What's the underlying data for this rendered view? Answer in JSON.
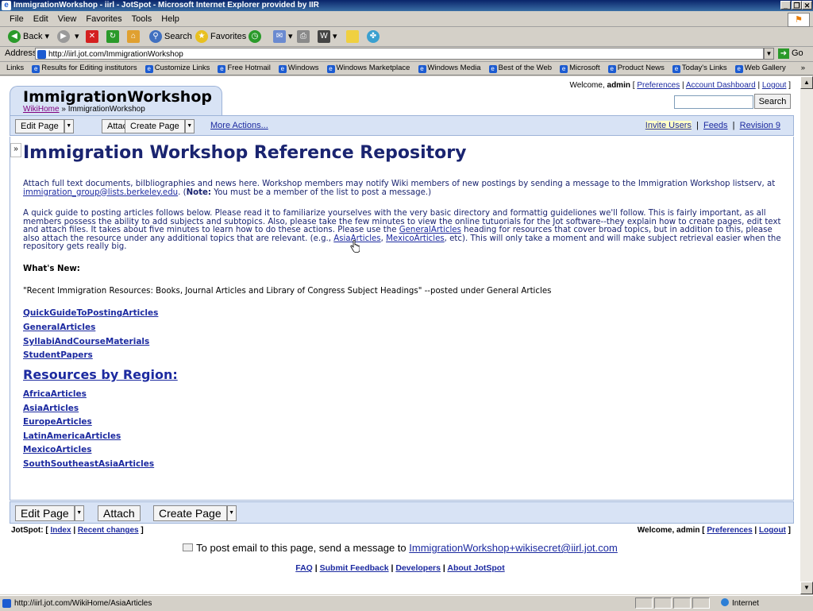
{
  "window": {
    "title": "ImmigrationWorkshop - iirl - JotSpot - Microsoft Internet Explorer provided by IIR"
  },
  "menu": [
    "File",
    "Edit",
    "View",
    "Favorites",
    "Tools",
    "Help"
  ],
  "toolbar": {
    "back": "Back",
    "search": "Search",
    "favorites": "Favorites"
  },
  "address": {
    "label": "Address",
    "url": "http://iirl.jot.com/ImmigrationWorkshop",
    "go": "Go"
  },
  "links": {
    "label": "Links",
    "items": [
      "Results for Editing institutors",
      "Customize Links",
      "Free Hotmail",
      "Windows",
      "Windows Marketplace",
      "Windows Media",
      "Best of the Web",
      "Microsoft",
      "Product News",
      "Today's Links",
      "Web Gallery"
    ]
  },
  "header": {
    "title": "ImmigrationWorkshop",
    "breadcrumb_home": "WikiHome",
    "breadcrumb_sep": " » ",
    "breadcrumb_current": "ImmigrationWorkshop",
    "welcome_prefix": "Welcome, ",
    "user": "admin",
    "preferences": "Preferences",
    "account_dashboard": "Account Dashboard",
    "logout": "Logout",
    "search_button": "Search"
  },
  "actions": {
    "edit_page": "Edit Page",
    "attach": "Attach",
    "create_page": "Create Page",
    "more_actions": "More Actions...",
    "invite_users": "Invite Users",
    "feeds": "Feeds",
    "revision": "Revision 9"
  },
  "content": {
    "heading": "Immigration Workshop Reference Repository",
    "intro_1": "Attach full text documents, bilbliographies and news here.  Workshop members may notify Wiki members of new postings by sending a message to the Immigration Workshop listserv, at",
    "intro_email": "immigration_group@lists.berkeley.edu",
    "intro_note_label": "Note:",
    "intro_note": "  You must be a member of the list to post a message.)",
    "guide_1": "A quick guide to posting articles follows below.  Please read it to familiarize yourselves with the very basic directory and formattig guideliones we'll follow.  This is fairly important, as all members possess the ability to add subjects and subtopics.  Also, please take the few minutes to view the online tutuorials for the Jot software--they explain how to create pages, edit text and attach files.  It takes about five minutes to learn how to do these actions.  Please use the ",
    "guide_link1": "GeneralArticles",
    "guide_2": " heading for resources that cover broad topics, but in addition to this, please also attach the resource under any additional topics that are relevant. (e.g., ",
    "guide_link2": "AsiaArticles",
    "guide_link3": "MexicoArticles",
    "guide_3": ", etc).  This will only take a moment and will make subject retrieval easier when the repository gets really big.",
    "whats_new_label": "What's New:",
    "recent": "\"Recent Immigration Resources:  Books, Journal Articles and  Library of Congress Subject Headings\" --posted under General Articles",
    "topic_links": [
      "QuickGuideToPostingArticles",
      "GeneralArticles",
      "SyllabiAndCourseMaterials",
      "StudentPapers"
    ],
    "region_heading": "Resources by Region:",
    "region_links": [
      "AfricaArticles",
      "AsiaArticles",
      "EuropeArticles",
      "LatinAmericaArticles",
      "MexicoArticles",
      "SouthSoutheastAsiaArticles"
    ]
  },
  "footer": {
    "jotspot": "JotSpot:",
    "index": "Index",
    "recent_changes": "Recent changes",
    "welcome": "Welcome, admin",
    "preferences": "Preferences",
    "logout": "Logout",
    "email_text": "To post email to this page, send a message to",
    "email_address": "ImmigrationWorkshop+wikisecret@iirl.jot.com",
    "faq": "FAQ",
    "submit_feedback": "Submit Feedback",
    "developers": "Developers",
    "about": "About JotSpot"
  },
  "status": {
    "url": "http://iirl.jot.com/WikiHome/AsiaArticles",
    "zone": "Internet"
  }
}
